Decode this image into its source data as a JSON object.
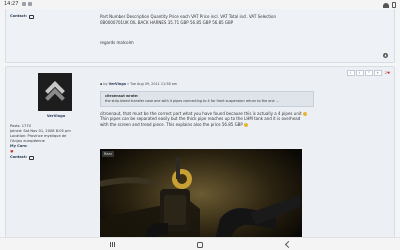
{
  "status_bar": {
    "time": "14:27"
  },
  "post1": {
    "contact_label": "Contact:",
    "lines": [
      "Part Number Description Quantity Price each VAT Price incl. VAT Total incl. VAT Selection",
      "0B0000701UK OIL BACK HARNES 35.71 GBP 56.85 GBP 56.85 GBP"
    ],
    "signoff": "regards malcolm"
  },
  "post2": {
    "username": "VerVinga",
    "info": {
      "posts": "Posts: 1770",
      "joined": "Joined: Sat Nov 01, 2008 8:05 pm",
      "location": "Location: Province mystique de l'Anjou européenne",
      "my_cars": "My Cars:",
      "contact": "Contact:"
    },
    "byline_prefix": "by",
    "byline_user": "VerVinga",
    "byline_date": "» Tue Aug 09, 2011 11:58 am",
    "actions": [
      "!",
      "i",
      "\"",
      "+"
    ],
    "likes": "2",
    "quote_author": "citroenaut wrote:",
    "quote_text": "the strip bleed transfer case one with 4 pipes connecting to 4 for front suspension return to the one ...",
    "body_lines": [
      "citroenaut, that must be the correct part what you have found because this is actually a 4 pipes unit",
      "Thin pipes can be separated easily but the thick pipe reaches up to the LHM tank and it is overhead",
      "with the screen and tread piece. This explains also the price 56.85 GBP"
    ],
    "photo_tag": "Rear"
  }
}
